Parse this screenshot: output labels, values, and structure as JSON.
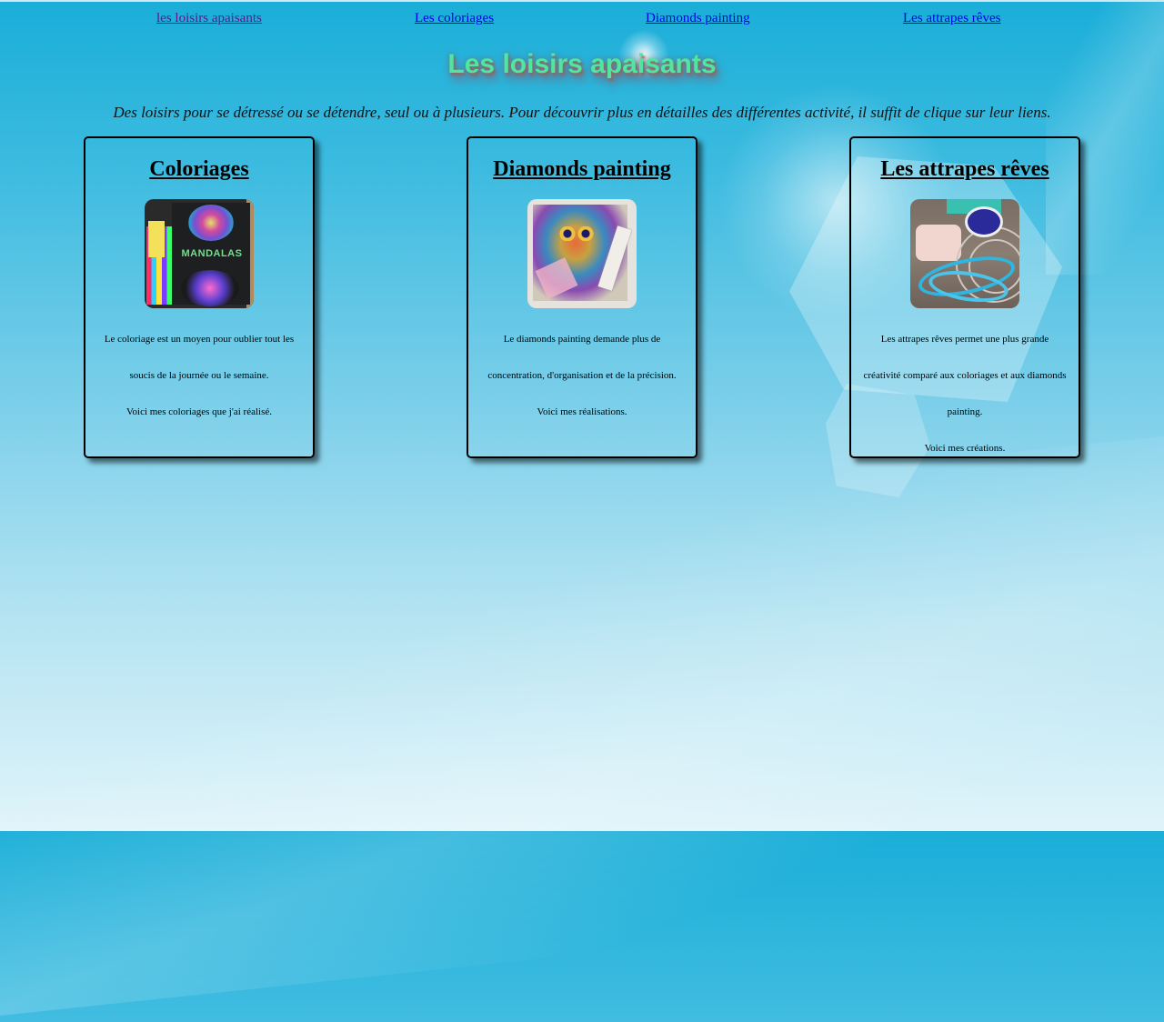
{
  "nav": {
    "links": [
      {
        "label": "les loisirs apaisants",
        "visited": true
      },
      {
        "label": "Les coloriages",
        "visited": false
      },
      {
        "label": "Diamonds painting",
        "visited": false
      },
      {
        "label": "Les attrapes rêves",
        "visited": false
      }
    ]
  },
  "header": {
    "title": "Les loisirs apaisants",
    "intro": "Des loisirs pour se détressé ou se détendre, seul ou à plusieurs. Pour découvrir plus en détailles des différentes activité, il suffit de clique sur leur liens."
  },
  "cards": [
    {
      "title": "Coloriages",
      "image": "coloring-book-photo",
      "paragraphs": [
        "Le coloriage est un moyen pour oublier tout les",
        "soucis de la journée ou le semaine.",
        "Voici mes coloriages que j'ai réalisé."
      ]
    },
    {
      "title": "Diamonds painting",
      "image": "diamond-painting-photo",
      "paragraphs": [
        "Le diamonds painting demande plus de",
        "concentration, d'organisation et de la précision.",
        "Voici mes réalisations."
      ]
    },
    {
      "title": "Les attrapes rêves",
      "image": "dream-catcher-photo",
      "paragraphs": [
        "Les attrapes rêves permet une plus grande",
        "créativité comparé aux coloriages et aux diamonds",
        "painting.",
        "Voici mes créations."
      ]
    }
  ],
  "thumb_labels": {
    "coloring_book_title": "MANDALAS"
  },
  "colors": {
    "title_green": "#4ee6a0",
    "link_blue": "#0000ee",
    "link_visited": "#551a8b",
    "background_top": "#1aaed8",
    "background_bottom": "#e0f4fa"
  }
}
